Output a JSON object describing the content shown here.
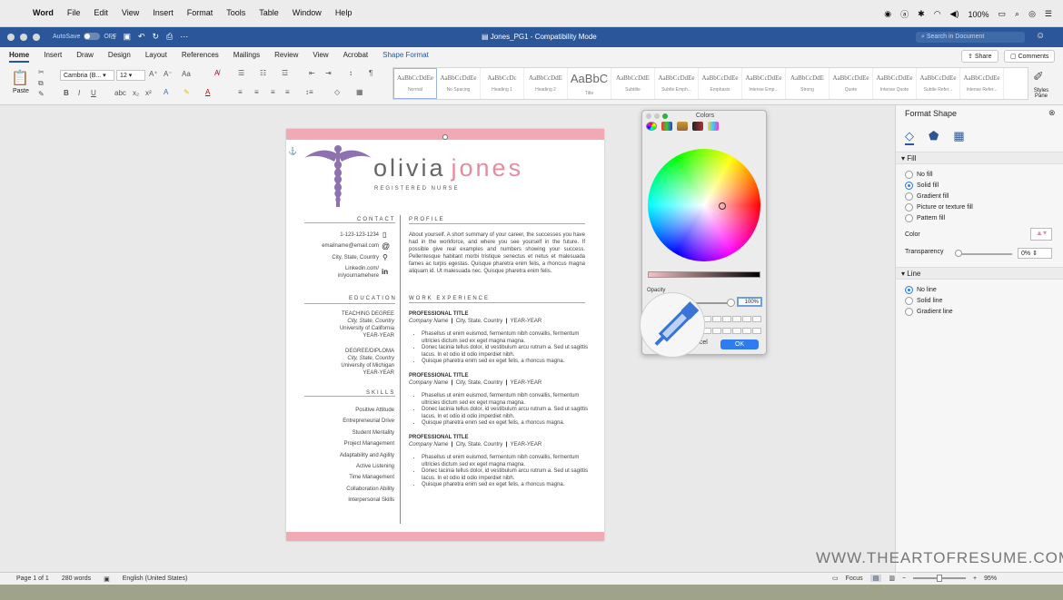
{
  "menubar": {
    "app": "Word",
    "items": [
      "File",
      "Edit",
      "View",
      "Insert",
      "Format",
      "Tools",
      "Table",
      "Window",
      "Help"
    ],
    "battery": "100%"
  },
  "titlebar": {
    "autosave": "AutoSave",
    "autosave_state": "OFF",
    "doc_title": "Jones_PG1 - Compatibility Mode",
    "search_placeholder": "Search in Document"
  },
  "ribbon_tabs": [
    "Home",
    "Insert",
    "Draw",
    "Design",
    "Layout",
    "References",
    "Mailings",
    "Review",
    "View",
    "Acrobat",
    "Shape Format"
  ],
  "share_label": "Share",
  "comments_label": "Comments",
  "ribbon": {
    "paste_label": "Paste",
    "font_name": "Cambria (B...",
    "font_size": "12",
    "styles_pane": "Styles Pane",
    "styles": [
      {
        "sample": "AaBbCcDdEe",
        "name": "Normal"
      },
      {
        "sample": "AaBbCcDdEe",
        "name": "No Spacing"
      },
      {
        "sample": "AaBbCcDc",
        "name": "Heading 1"
      },
      {
        "sample": "AaBbCcDdE",
        "name": "Heading 2"
      },
      {
        "sample": "AaBbC",
        "name": "Title"
      },
      {
        "sample": "AaBbCcDdE",
        "name": "Subtitle"
      },
      {
        "sample": "AaBbCcDdEe",
        "name": "Subtle Emph..."
      },
      {
        "sample": "AaBbCcDdEe",
        "name": "Emphasis"
      },
      {
        "sample": "AaBbCcDdEe",
        "name": "Intense Emp..."
      },
      {
        "sample": "AaBbCcDdE",
        "name": "Strong"
      },
      {
        "sample": "AaBbCcDdEe",
        "name": "Quote"
      },
      {
        "sample": "AaBbCcDdEe",
        "name": "Intense Quote"
      },
      {
        "sample": "AaBbCcDdEe",
        "name": "Subtle Refer..."
      },
      {
        "sample": "AaBbCcDdEe",
        "name": "Intense Refer..."
      }
    ]
  },
  "resume": {
    "first_name": "olivia",
    "last_name": "jones",
    "role": "REGISTERED NURSE",
    "contact_head": "CONTACT",
    "phone": "1-123-123-1234",
    "email": "emailname@email.com",
    "location": "City, State, Country",
    "linkedin": "Linkedin.com/\nin/yournamehere",
    "education_head": "EDUCATION",
    "edu": [
      {
        "degree": "TEACHING DEGREE",
        "place": "City, State, Country",
        "school": "University of California",
        "years": "YEAR-YEAR"
      },
      {
        "degree": "DEGREE/DIPLOMA",
        "place": "City, State, Country",
        "school": "University of Michigan",
        "years": "YEAR-YEAR"
      }
    ],
    "skills_head": "SKILLS",
    "skills": [
      "Positive Attitude",
      "Entrepreneurial Drive",
      "Student Mentality",
      "Project Management",
      "Adaptability and Agility",
      "Active Listening",
      "Time Management",
      "Collaboration Ability",
      "Interpersonal Skills"
    ],
    "profile_head": "PROFILE",
    "profile_text": "About yourself. A short summary of your career, the successes you have had in the workforce, and where you see yourself in the future. If possible give real examples and numbers showing your success. Pellentesque habitant morbi tristique senectus et netus et malesuada fames ac turpis egestas. Quisque pharetra enim felis, a rhoncus magna aliquam id. Ut malesuada nec. Quisque pharetra enim felis.",
    "work_head": "WORK EXPERIENCE",
    "jobs": [
      {
        "title": "PROFESSIONAL TITLE",
        "company": "Company Name",
        "loc": "City, State, Country",
        "years": "YEAR-YEAR"
      },
      {
        "title": "PROFESSIONAL TITLE",
        "company": "Company Name",
        "loc": "City, State, Country",
        "years": "YEAR-YEAR"
      },
      {
        "title": "PROFESSIONAL TITLE",
        "company": "Company Name",
        "loc": "City, State, Country",
        "years": "YEAR-YEAR"
      }
    ],
    "bullets": [
      "Phasellus ut enim euismod, fermentum nibh convallis, fermentum ultricies dictum sed ex eget magna magna.",
      "Donec lacinia tellus dolor, id vestibulum arcu rutrum a. Sed ut sagittis lacus. In et odio id odio imperdiet nibh.",
      "Quisque pharetra enim sed ex eget felis, a rhoncus magna."
    ]
  },
  "colors_dialog": {
    "title": "Colors",
    "opacity_label": "Opacity",
    "opacity_value": "100%",
    "cancel": "Cancel",
    "ok": "OK"
  },
  "panel": {
    "title": "Format Shape",
    "fill_head": "Fill",
    "fill_options": [
      "No fill",
      "Solid fill",
      "Gradient fill",
      "Picture or texture fill",
      "Pattern fill"
    ],
    "fill_selected": 1,
    "color_label": "Color",
    "transparency_label": "Transparency",
    "transparency_value": "0%",
    "line_head": "Line",
    "line_options": [
      "No line",
      "Solid line",
      "Gradient line"
    ],
    "line_selected": 0
  },
  "status": {
    "page": "Page 1 of 1",
    "words": "280 words",
    "language": "English (United States)",
    "focus": "Focus",
    "zoom": "95%"
  },
  "watermark": "WWW.THEARTOFRESUME.COM",
  "colors": {
    "accent": "#2b579a",
    "pink": "#f1a9b4",
    "name_pink": "#e38d9f",
    "logo": "#8e72b0"
  }
}
